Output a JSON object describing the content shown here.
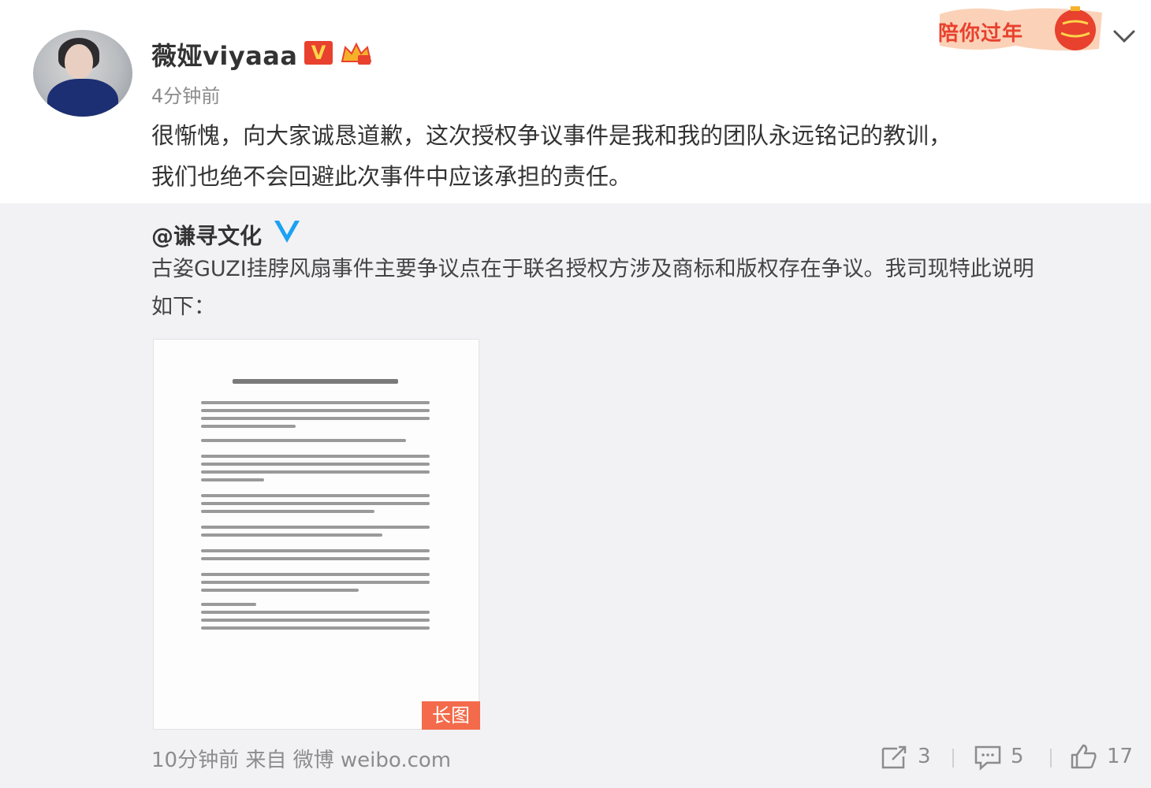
{
  "post": {
    "username": "薇娅viyaaa",
    "verified_badge": "V",
    "timestamp": "4分钟前",
    "text_line1": "很惭愧，向大家诚恳道歉，这次授权争议事件是我和我的团队永远铭记的教训，",
    "text_line2": "我们也绝不会回避此次事件中应该承担的责任。",
    "banner_text": "陪你过年",
    "icons": {
      "badge": "verified-badge-icon",
      "level": "crown-level-icon",
      "banner": "new-year-lantern-icon",
      "menu": "chevron-down-icon"
    },
    "colors": {
      "accent": "#e8412e",
      "repost_bg": "#f2f2f5",
      "tag": "#f36b4b",
      "blue_v": "#1da1f2"
    }
  },
  "repost": {
    "author": "@谦寻文化",
    "text_line1": "古姿GUZI挂脖风扇事件主要争议点在于联名授权方涉及商标和版权存在争议。我司现特此说明",
    "text_line2": "如下：",
    "image_tag": "长图",
    "source": "10分钟前 来自 微博 weibo.com",
    "actions": {
      "repost_count": "3",
      "comment_count": "5",
      "like_count": "17"
    },
    "icons": [
      "blue-v-icon",
      "repost-icon",
      "comment-icon",
      "like-icon"
    ]
  }
}
